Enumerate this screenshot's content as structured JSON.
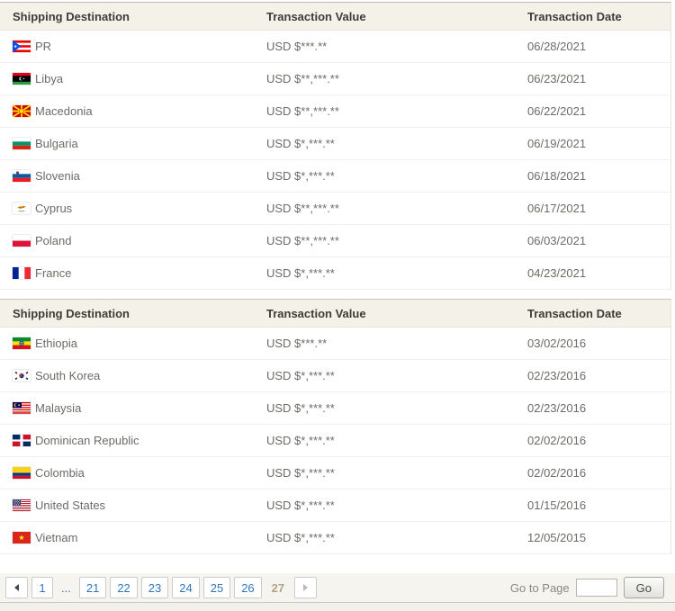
{
  "colors": {
    "header_bg": "#f4f1e9",
    "header_text": "#3e3c37",
    "row_text": "#6e6b66",
    "link_blue": "#2e76bd",
    "current_page_tan": "#b3a384",
    "footer_bg": "#f5f4ef"
  },
  "tables": [
    {
      "columns": [
        "Shipping Destination",
        "Transaction Value",
        "Transaction Date"
      ],
      "rows": [
        {
          "country": "PR",
          "flag": "puerto-rico",
          "value": "USD $***.**",
          "date": "06/28/2021"
        },
        {
          "country": "Libya",
          "flag": "libya",
          "value": "USD $**,***.**",
          "date": "06/23/2021"
        },
        {
          "country": "Macedonia",
          "flag": "macedonia",
          "value": "USD $**,***.**",
          "date": "06/22/2021"
        },
        {
          "country": "Bulgaria",
          "flag": "bulgaria",
          "value": "USD $*,***.**",
          "date": "06/19/2021"
        },
        {
          "country": "Slovenia",
          "flag": "slovenia",
          "value": "USD $*,***.**",
          "date": "06/18/2021"
        },
        {
          "country": "Cyprus",
          "flag": "cyprus",
          "value": "USD $**,***.**",
          "date": "06/17/2021"
        },
        {
          "country": "Poland",
          "flag": "poland",
          "value": "USD $**,***.**",
          "date": "06/03/2021"
        },
        {
          "country": "France",
          "flag": "france",
          "value": "USD $*,***.**",
          "date": "04/23/2021"
        }
      ]
    },
    {
      "columns": [
        "Shipping Destination",
        "Transaction Value",
        "Transaction Date"
      ],
      "rows": [
        {
          "country": "Ethiopia",
          "flag": "ethiopia",
          "value": "USD $***.**",
          "date": "03/02/2016"
        },
        {
          "country": "South Korea",
          "flag": "south-korea",
          "value": "USD $*,***.**",
          "date": "02/23/2016"
        },
        {
          "country": "Malaysia",
          "flag": "malaysia",
          "value": "USD $*,***.**",
          "date": "02/23/2016"
        },
        {
          "country": "Dominican Republic",
          "flag": "dominican-republic",
          "value": "USD $*,***.**",
          "date": "02/02/2016"
        },
        {
          "country": "Colombia",
          "flag": "colombia",
          "value": "USD $*,***.**",
          "date": "02/02/2016"
        },
        {
          "country": "United States",
          "flag": "united-states",
          "value": "USD $*,***.**",
          "date": "01/15/2016"
        },
        {
          "country": "Vietnam",
          "flag": "vietnam",
          "value": "USD $*,***.**",
          "date": "12/05/2015"
        }
      ]
    }
  ],
  "pagination": {
    "prev_icon": "left-triangle",
    "next_icon": "right-triangle",
    "pages": [
      "1",
      "21",
      "22",
      "23",
      "24",
      "25",
      "26"
    ],
    "ellipsis": "...",
    "current": "27",
    "goto_label": "Go to Page",
    "goto_value": "",
    "go_button": "Go"
  }
}
